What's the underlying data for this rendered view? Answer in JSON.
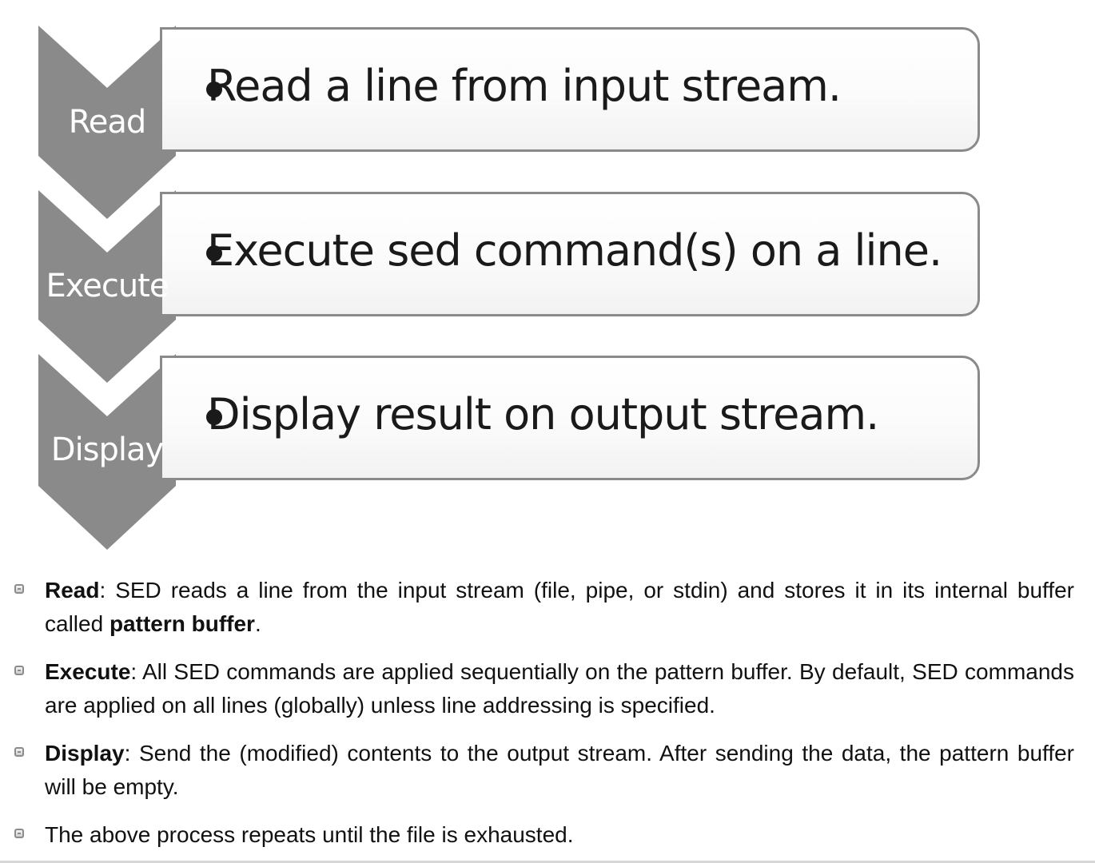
{
  "diagram": {
    "steps": [
      {
        "label": "Read",
        "text": "Read a line from input stream."
      },
      {
        "label": "Execute",
        "text": "Execute sed command(s) on a line."
      },
      {
        "label": "Display",
        "text": "Display result on output stream."
      }
    ],
    "colors": {
      "chevron": "#8a8a8a",
      "box_border": "#8a8a8a",
      "box_fill": "#fbfbfb",
      "label_text": "#ffffff"
    }
  },
  "notes": [
    {
      "term": "Read",
      "t1": ": SED reads a line from the input stream (file, pipe, or stdin) and stores it in its internal buffer called ",
      "term2": "pattern buffer",
      "t2": "."
    },
    {
      "term": "Execute",
      "t1": ": All SED commands are applied sequentially on the pattern buffer. By default, SED commands are applied on all lines (globally) unless line addressing is specified."
    },
    {
      "term": "Display",
      "t1": ": Send the (modified) contents to the output stream. After sending the data, the pattern buffer will be empty."
    },
    {
      "t1": "The above process repeats until the file is exhausted."
    }
  ]
}
